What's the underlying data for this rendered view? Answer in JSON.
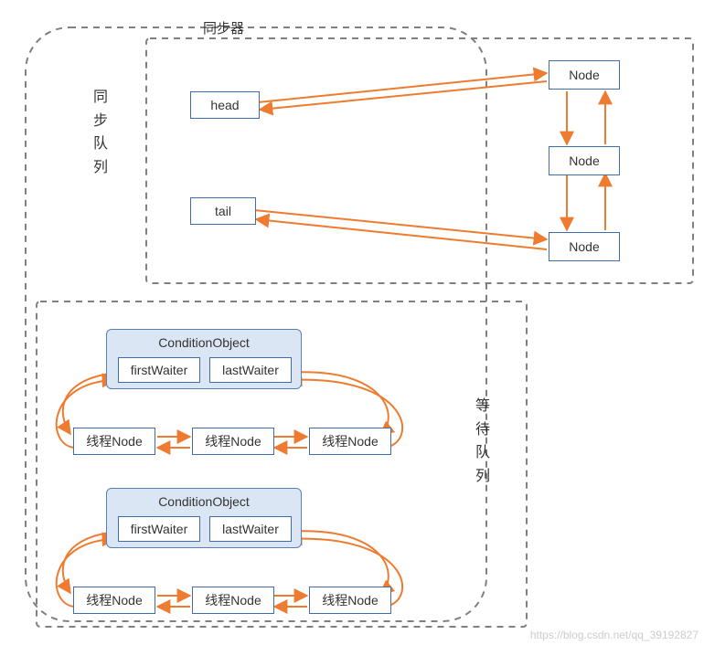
{
  "labels": {
    "synchronizer": "同步器",
    "syncQueue": [
      "同",
      "步",
      "队",
      "列"
    ],
    "waitQueue": [
      "等",
      "待",
      "队",
      "列"
    ]
  },
  "sync": {
    "head": "head",
    "tail": "tail",
    "nodes": [
      "Node",
      "Node",
      "Node"
    ]
  },
  "condition": {
    "title": "ConditionObject",
    "first": "firstWaiter",
    "last": "lastWaiter",
    "threadNode": "线程Node"
  },
  "watermark": "https://blog.csdn.net/qq_39192827"
}
